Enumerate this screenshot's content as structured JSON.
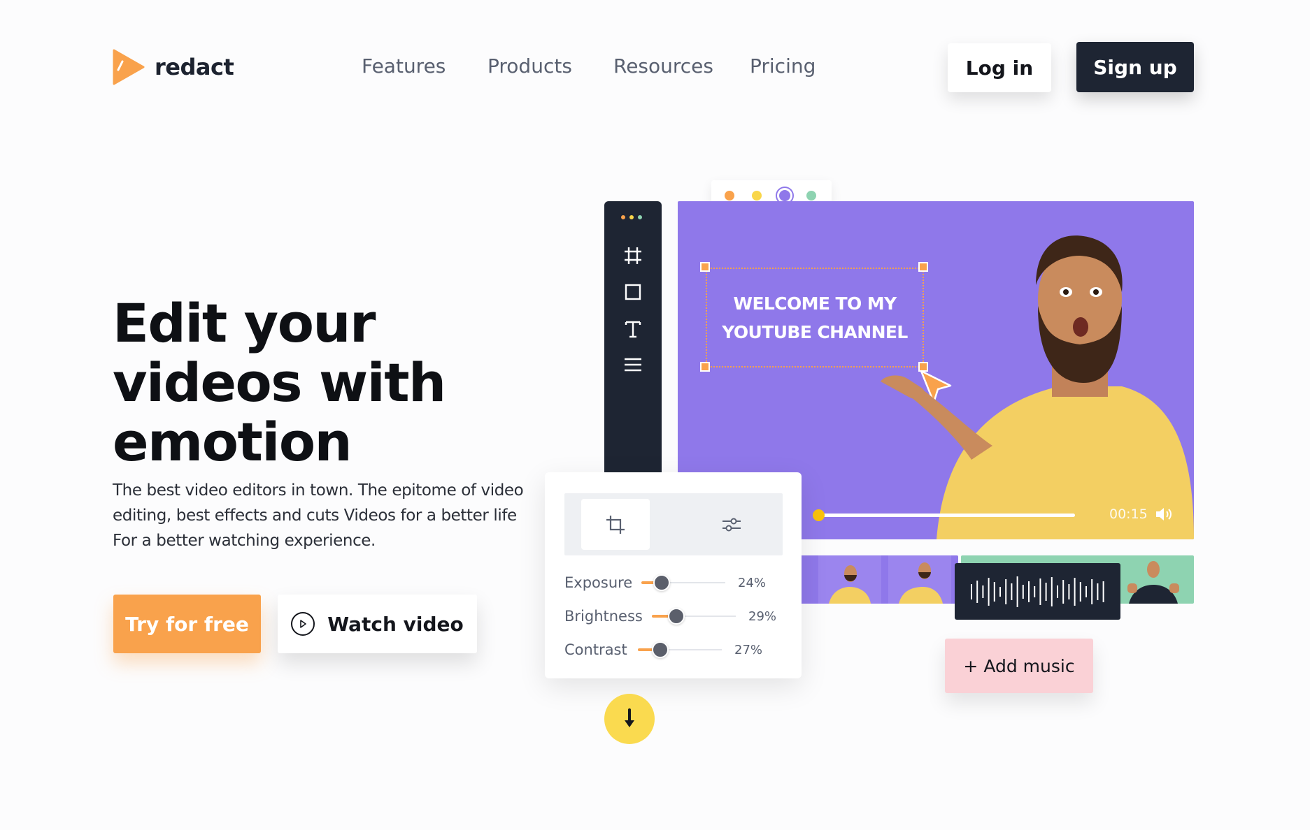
{
  "brand": {
    "name": "redact",
    "logo_color": "#f9a24c"
  },
  "nav": {
    "items": [
      "Features",
      "Products",
      "Resources",
      "Pricing"
    ],
    "login_label": "Log in",
    "signup_label": "Sign up"
  },
  "hero": {
    "title_lines": [
      "Edit your",
      "videos with",
      "emotion"
    ],
    "subtitle_lines": [
      "The best video editors in town. The epitome of video",
      "editing, best effects and cuts Videos for a better life",
      "For a better watching experience."
    ],
    "try_label": "Try for free",
    "watch_label": "Watch video"
  },
  "editor": {
    "color_swatches": [
      "#f9a24c",
      "#f9d64a",
      "#8f78ea",
      "#8ed3b1"
    ],
    "overlay_text": [
      "WELCOME TO MY",
      "YOUTUBE CHANNEL"
    ],
    "video_time": "00:15",
    "video_progress": 0.02,
    "add_music_label": "+ Add music",
    "adjustments": [
      {
        "label": "Exposure",
        "value": "24%",
        "fraction": 0.24
      },
      {
        "label": "Brightness",
        "value": "29%",
        "fraction": 0.29
      },
      {
        "label": "Contrast",
        "value": "27%",
        "fraction": 0.27
      }
    ]
  },
  "colors": {
    "accent_orange": "#f9a24c",
    "dark_navy": "#1e2533",
    "video_purple": "#8f78ea",
    "mint": "#8ed3b1",
    "pink": "#fad1d6",
    "yellow": "#fada4f"
  }
}
